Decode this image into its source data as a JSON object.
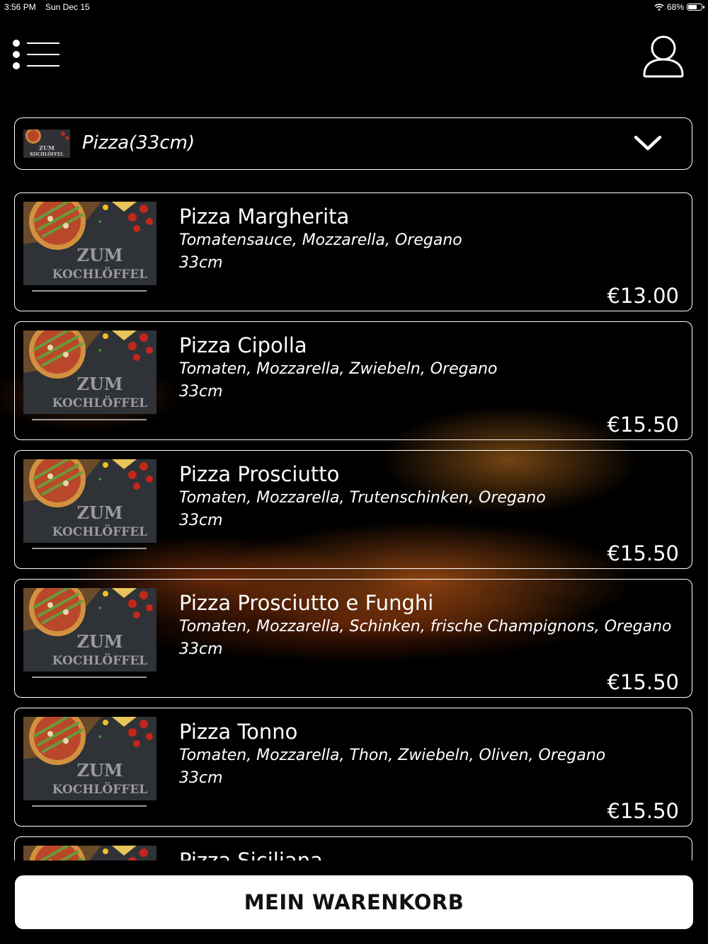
{
  "status_bar": {
    "time": "3:56 PM",
    "date": "Sun Dec 15",
    "battery": "68%",
    "battery_level": 0.68
  },
  "header": {
    "menu_icon": "hamburger-menu-icon",
    "profile_icon": "user-profile-icon"
  },
  "category": {
    "selected": "Pizza(33cm)",
    "thumb_text_1": "ZUM",
    "thumb_text_2": "KOCHLÖFFEL"
  },
  "logo": {
    "line1": "ZUM",
    "line2": "KOCHLÖFFEL"
  },
  "products": [
    {
      "name": "Pizza Margherita",
      "description": "Tomatensauce, Mozzarella, Oregano",
      "size": "33cm",
      "price": "€13.00"
    },
    {
      "name": "Pizza Cipolla",
      "description": "Tomaten, Mozzarella, Zwiebeln, Oregano",
      "size": "33cm",
      "price": "€15.50"
    },
    {
      "name": "Pizza Prosciutto",
      "description": "Tomaten, Mozzarella, Trutenschinken, Oregano",
      "size": "33cm",
      "price": "€15.50"
    },
    {
      "name": "Pizza Prosciutto e Funghi",
      "description": "Tomaten, Mozzarella, Schinken, frische Champignons, Oregano",
      "size": "33cm",
      "price": "€15.50"
    },
    {
      "name": "Pizza Tonno",
      "description": "Tomaten, Mozzarella, Thon, Zwiebeln, Oliven, Oregano",
      "size": "33cm",
      "price": "€15.50"
    },
    {
      "name": "Pizza Siciliana",
      "description": "",
      "size": "",
      "price": ""
    }
  ],
  "cart": {
    "label": "MEIN WARENKORB"
  },
  "colors": {
    "background": "#000000",
    "foreground": "#ffffff",
    "button_bg": "#ffffff",
    "button_text": "#111111"
  }
}
